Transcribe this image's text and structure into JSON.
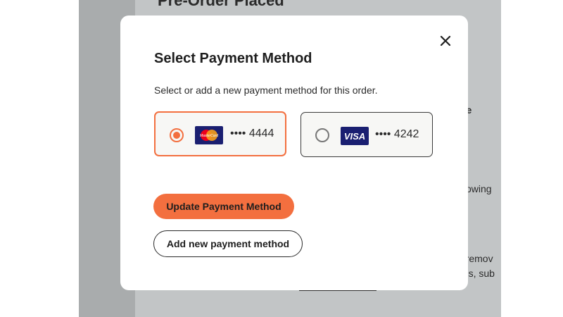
{
  "background": {
    "title": "Pre-Order Placed",
    "snippets": [
      "lue",
      "ollowing",
      "o remov",
      "ons, sub"
    ]
  },
  "modal": {
    "title": "Select Payment Method",
    "description": "Select or add a new payment method for this order.",
    "close_icon": "close-icon",
    "payment_options": [
      {
        "brand": "MasterCard",
        "masked_number": "•••• 4444",
        "selected": true
      },
      {
        "brand": "VISA",
        "masked_number": "•••• 4242",
        "selected": false
      }
    ],
    "update_button": "Update Payment Method",
    "add_button": "Add new payment method"
  },
  "colors": {
    "accent": "#f36f3f",
    "overlay": "#a9acad",
    "visa_blue": "#1a1f71"
  }
}
